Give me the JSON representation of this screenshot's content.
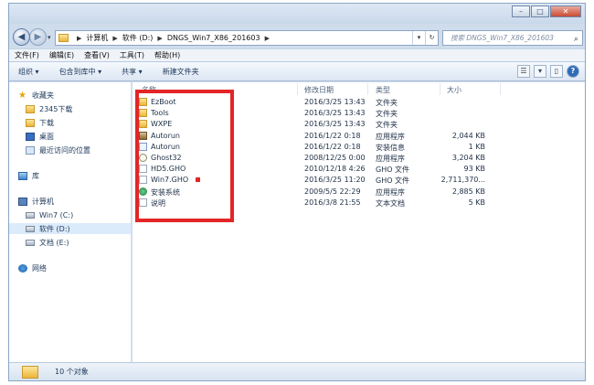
{
  "address": {
    "crumbs": [
      "计算机",
      "软件 (D:)",
      "DNGS_Win7_X86_201603"
    ]
  },
  "search": {
    "placeholder": "搜索 DNGS_Win7_X86_201603"
  },
  "menu": [
    "文件(F)",
    "编辑(E)",
    "查看(V)",
    "工具(T)",
    "帮助(H)"
  ],
  "toolbar": {
    "organize": "组织 ▾",
    "include": "包含到库中 ▾",
    "share": "共享 ▾",
    "new_folder": "新建文件夹"
  },
  "sidebar": {
    "favorites": "收藏夹",
    "fav_items": [
      "2345下载",
      "下载",
      "桌面",
      "最近访问的位置"
    ],
    "libraries": "库",
    "computer": "计算机",
    "drives": [
      "Win7 (C:)",
      "软件 (D:)",
      "文档 (E:)"
    ],
    "network": "网络"
  },
  "columns": {
    "name": "名称",
    "date": "修改日期",
    "type": "类型",
    "size": "大小"
  },
  "files": [
    {
      "name": "EzBoot",
      "date": "2016/3/25 13:43",
      "type": "文件夹",
      "size": "",
      "icon": "folder"
    },
    {
      "name": "Tools",
      "date": "2016/3/25 13:43",
      "type": "文件夹",
      "size": "",
      "icon": "folder"
    },
    {
      "name": "WXPE",
      "date": "2016/3/25 13:43",
      "type": "文件夹",
      "size": "",
      "icon": "folder"
    },
    {
      "name": "Autorun",
      "date": "2016/1/22 0:18",
      "type": "应用程序",
      "size": "2,044 KB",
      "icon": "autorun-exe"
    },
    {
      "name": "Autorun",
      "date": "2016/1/22 0:18",
      "type": "安装信息",
      "size": "1 KB",
      "icon": "inf"
    },
    {
      "name": "Ghost32",
      "date": "2008/12/25 0:00",
      "type": "应用程序",
      "size": "3,204 KB",
      "icon": "ghost"
    },
    {
      "name": "HD5.GHO",
      "date": "2010/12/18 4:26",
      "type": "GHO 文件",
      "size": "93 KB",
      "icon": "gho"
    },
    {
      "name": "Win7.GHO",
      "date": "2016/3/25 11:20",
      "type": "GHO 文件",
      "size": "2,711,370...",
      "icon": "gho"
    },
    {
      "name": "安装系统",
      "date": "2009/5/5 22:29",
      "type": "应用程序",
      "size": "2,885 KB",
      "icon": "setup"
    },
    {
      "name": "说明",
      "date": "2016/3/8 21:55",
      "type": "文本文档",
      "size": "5 KB",
      "icon": "txt"
    }
  ],
  "status": {
    "count": "10 个对象"
  },
  "colors": {
    "highlight": "#e32526",
    "chrome": "#cfdcec"
  }
}
